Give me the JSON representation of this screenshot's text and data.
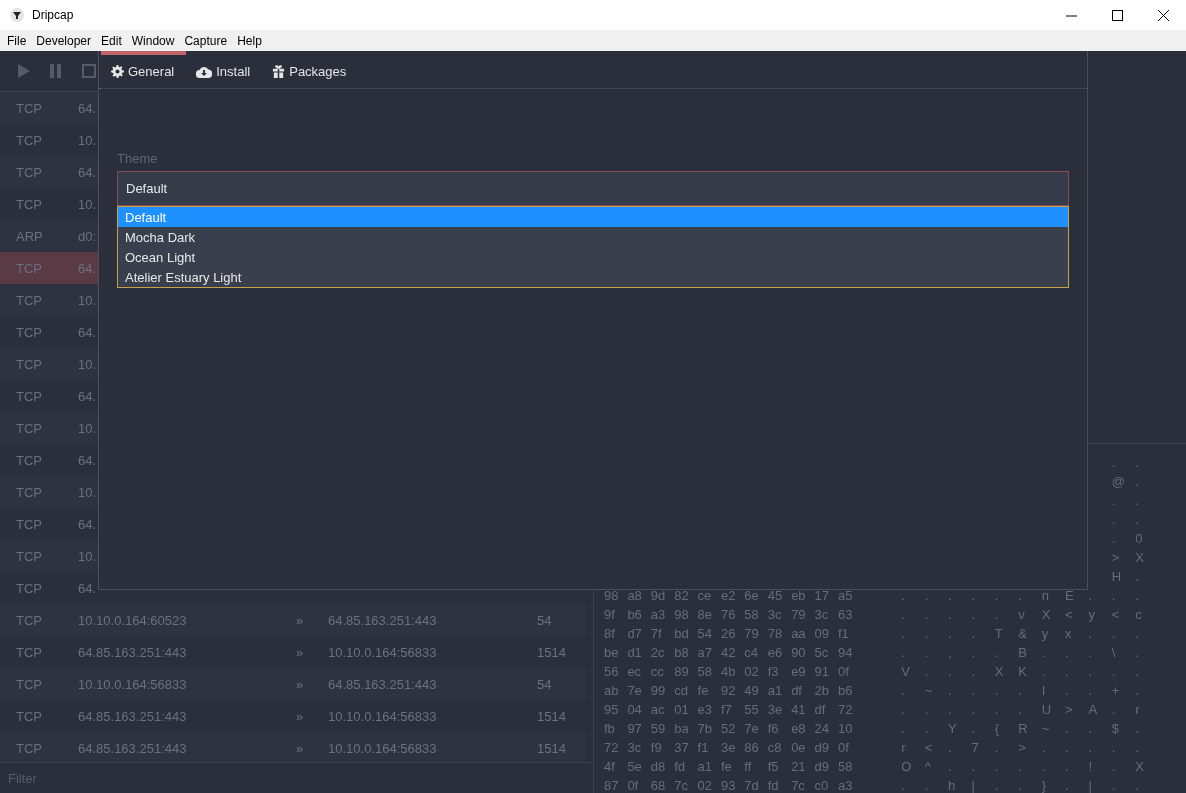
{
  "window": {
    "title": "Dripcap"
  },
  "menu": [
    "File",
    "Developer",
    "Edit",
    "Window",
    "Capture",
    "Help"
  ],
  "toolbar": [
    {
      "kind": "play"
    },
    {
      "kind": "pause"
    },
    {
      "kind": "stop"
    }
  ],
  "packets": [
    {
      "protocol": "TCP",
      "source": "64.",
      "selected": false
    },
    {
      "protocol": "TCP",
      "source": "10.",
      "selected": false
    },
    {
      "protocol": "TCP",
      "source": "64.",
      "selected": false
    },
    {
      "protocol": "TCP",
      "source": "10.",
      "selected": false
    },
    {
      "protocol": "ARP",
      "source": "d0:",
      "selected": false
    },
    {
      "protocol": "TCP",
      "source": "64.",
      "selected": true
    },
    {
      "protocol": "TCP",
      "source": "10.",
      "selected": false
    },
    {
      "protocol": "TCP",
      "source": "64.",
      "selected": false
    },
    {
      "protocol": "TCP",
      "source": "10.",
      "selected": false
    },
    {
      "protocol": "TCP",
      "source": "64.",
      "selected": false
    },
    {
      "protocol": "TCP",
      "source": "10.",
      "selected": false
    },
    {
      "protocol": "TCP",
      "source": "64.",
      "selected": false
    },
    {
      "protocol": "TCP",
      "source": "10.",
      "selected": false
    },
    {
      "protocol": "TCP",
      "source": "64.",
      "selected": false
    },
    {
      "protocol": "TCP",
      "source": "10.",
      "selected": false
    },
    {
      "protocol": "TCP",
      "source": "64.",
      "selected": false
    },
    {
      "protocol": "TCP",
      "source": "10.10.0.164:60523",
      "arrow": "»",
      "destination": "64.85.163.251:443",
      "length": "54",
      "selected": false
    },
    {
      "protocol": "TCP",
      "source": "64.85.163.251:443",
      "arrow": "»",
      "destination": "10.10.0.164:56833",
      "length": "1514",
      "selected": false
    },
    {
      "protocol": "TCP",
      "source": "10.10.0.164:56833",
      "arrow": "»",
      "destination": "64.85.163.251:443",
      "length": "54",
      "selected": false
    },
    {
      "protocol": "TCP",
      "source": "64.85.163.251:443",
      "arrow": "»",
      "destination": "10.10.0.164:56833",
      "length": "1514",
      "selected": false
    },
    {
      "protocol": "TCP",
      "source": "64.85.163.251:443",
      "arrow": "»",
      "destination": "10.10.0.164:56833",
      "length": "1514",
      "selected": false
    }
  ],
  "filter": {
    "placeholder": "Filter"
  },
  "hex_rows": [
    {
      "ascii": [
        ".",
        "."
      ]
    },
    {
      "ascii": [
        "@",
        "."
      ]
    },
    {
      "ascii": [
        ".",
        "."
      ]
    },
    {
      "ascii": [
        ".",
        "."
      ]
    },
    {
      "ascii": [
        ".",
        "0"
      ]
    },
    {
      "ascii": [
        ">",
        "X"
      ]
    },
    {
      "ascii": [
        "H",
        "."
      ]
    },
    {
      "bytes": [
        "98",
        "a8",
        "9d",
        "82",
        "ce",
        "e2",
        "6e",
        "45",
        "eb",
        "17",
        "a5"
      ],
      "ascii": [
        ".",
        ".",
        ".",
        ".",
        ".",
        ".",
        "n",
        "E",
        ".",
        ".",
        "."
      ]
    },
    {
      "bytes": [
        "9f",
        "b6",
        "a3",
        "98",
        "8e",
        "76",
        "58",
        "3c",
        "79",
        "3c",
        "63"
      ],
      "ascii": [
        ".",
        ".",
        ".",
        ".",
        ".",
        "v",
        "X",
        "<",
        "y",
        "<",
        "c"
      ]
    },
    {
      "bytes": [
        "8f",
        "d7",
        "7f",
        "bd",
        "54",
        "26",
        "79",
        "78",
        "aa",
        "09",
        "f1"
      ],
      "ascii": [
        ".",
        ".",
        ".",
        ".",
        "T",
        "&",
        "y",
        "x",
        ".",
        ".",
        "."
      ]
    },
    {
      "bytes": [
        "be",
        "d1",
        "2c",
        "b8",
        "a7",
        "42",
        "c4",
        "e6",
        "90",
        "5c",
        "94"
      ],
      "ascii": [
        ".",
        ".",
        ",",
        ".",
        ".",
        "B",
        ".",
        ".",
        ".",
        "\\",
        "."
      ]
    },
    {
      "bytes": [
        "56",
        "ec",
        "cc",
        "89",
        "58",
        "4b",
        "02",
        "f3",
        "e9",
        "91",
        "0f"
      ],
      "ascii": [
        "V",
        ".",
        ".",
        ".",
        "X",
        "K",
        ".",
        ".",
        ".",
        ".",
        "."
      ]
    },
    {
      "bytes": [
        "ab",
        "7e",
        "99",
        "cd",
        "fe",
        "92",
        "49",
        "a1",
        "df",
        "2b",
        "b6"
      ],
      "ascii": [
        ".",
        "~",
        ".",
        ".",
        ".",
        ".",
        "I",
        ".",
        ".",
        "+",
        "."
      ]
    },
    {
      "bytes": [
        "95",
        "04",
        "ac",
        "01",
        "e3",
        "f7",
        "55",
        "3e",
        "41",
        "df",
        "72"
      ],
      "ascii": [
        ".",
        ".",
        ".",
        ".",
        ".",
        ".",
        "U",
        ">",
        "A",
        ".",
        "r"
      ]
    },
    {
      "bytes": [
        "fb",
        "97",
        "59",
        "ba",
        "7b",
        "52",
        "7e",
        "f6",
        "e8",
        "24",
        "10"
      ],
      "ascii": [
        ".",
        ".",
        "Y",
        ".",
        "{",
        "R",
        "~",
        ".",
        ".",
        "$",
        "."
      ]
    },
    {
      "bytes": [
        "72",
        "3c",
        "f9",
        "37",
        "f1",
        "3e",
        "86",
        "c8",
        "0e",
        "d9",
        "0f"
      ],
      "ascii": [
        "r",
        "<",
        ".",
        "7",
        ".",
        ">",
        ".",
        ".",
        ".",
        ".",
        "."
      ]
    },
    {
      "bytes": [
        "4f",
        "5e",
        "d8",
        "fd",
        "a1",
        "fe",
        "ff",
        "f5",
        "21",
        "d9",
        "58"
      ],
      "ascii": [
        "O",
        "^",
        ".",
        ".",
        ".",
        ".",
        ".",
        ".",
        "!",
        ".",
        "X"
      ]
    },
    {
      "bytes": [
        "87",
        "0f",
        "68",
        "7c",
        "02",
        "93",
        "7d",
        "fd",
        "7c",
        "c0",
        "a3"
      ],
      "ascii": [
        ".",
        ".",
        "h",
        "|",
        ".",
        ".",
        "}",
        ".",
        "|",
        ".",
        "."
      ]
    }
  ],
  "dialog": {
    "tabs": [
      {
        "label": "General",
        "kind": "gear",
        "selected": true
      },
      {
        "label": "Install",
        "kind": "cloud",
        "selected": false
      },
      {
        "label": "Packages",
        "kind": "gift",
        "selected": false
      }
    ],
    "theme": {
      "label": "Theme",
      "value": "Default",
      "options": [
        {
          "label": "Default",
          "selected": true
        },
        {
          "label": "Mocha Dark",
          "selected": false
        },
        {
          "label": "Ocean Light",
          "selected": false
        },
        {
          "label": "Atelier Estuary Light",
          "selected": false
        }
      ]
    }
  }
}
